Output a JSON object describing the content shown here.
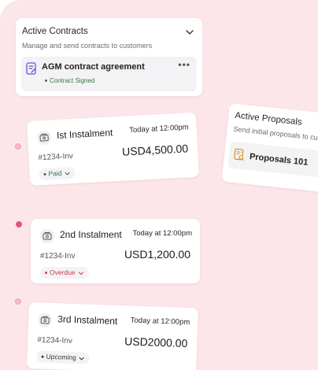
{
  "contracts": {
    "title": "Active Contracts",
    "subtitle": "Manage and send contracts to customers",
    "item": {
      "name": "AGM contract agreement",
      "status": "Contract Signed"
    }
  },
  "proposals": {
    "title": "Active Proposals",
    "subtitle": "Send initial proposals to cust",
    "item": {
      "name": "Proposals 101"
    }
  },
  "instalments": [
    {
      "name": "Ist Instalment",
      "time": "Today at 12:00pm",
      "invoice": "#1234-Inv",
      "amount": "USD4,500.00",
      "status": "Paid"
    },
    {
      "name": "2nd Instalment",
      "time": "Today at 12:00pm",
      "invoice": "#1234-Inv",
      "amount": "USD1,200.00",
      "status": "Overdue"
    },
    {
      "name": "3rd Instalment",
      "time": "Today at 12:00pm",
      "invoice": "#1234-Inv",
      "amount": "USD2000.00",
      "status": "Upcoming"
    }
  ],
  "colors": {
    "background": "#fde6e9",
    "paid": "#2f7a43",
    "overdue": "#c43c51",
    "timeline_active": "#e05a73"
  },
  "icons": {
    "contract": "document-edit-icon",
    "proposal": "document-search-icon",
    "instalment": "money-stack-icon",
    "expand": "chevron-down-icon",
    "more": "more-horizontal-icon"
  }
}
